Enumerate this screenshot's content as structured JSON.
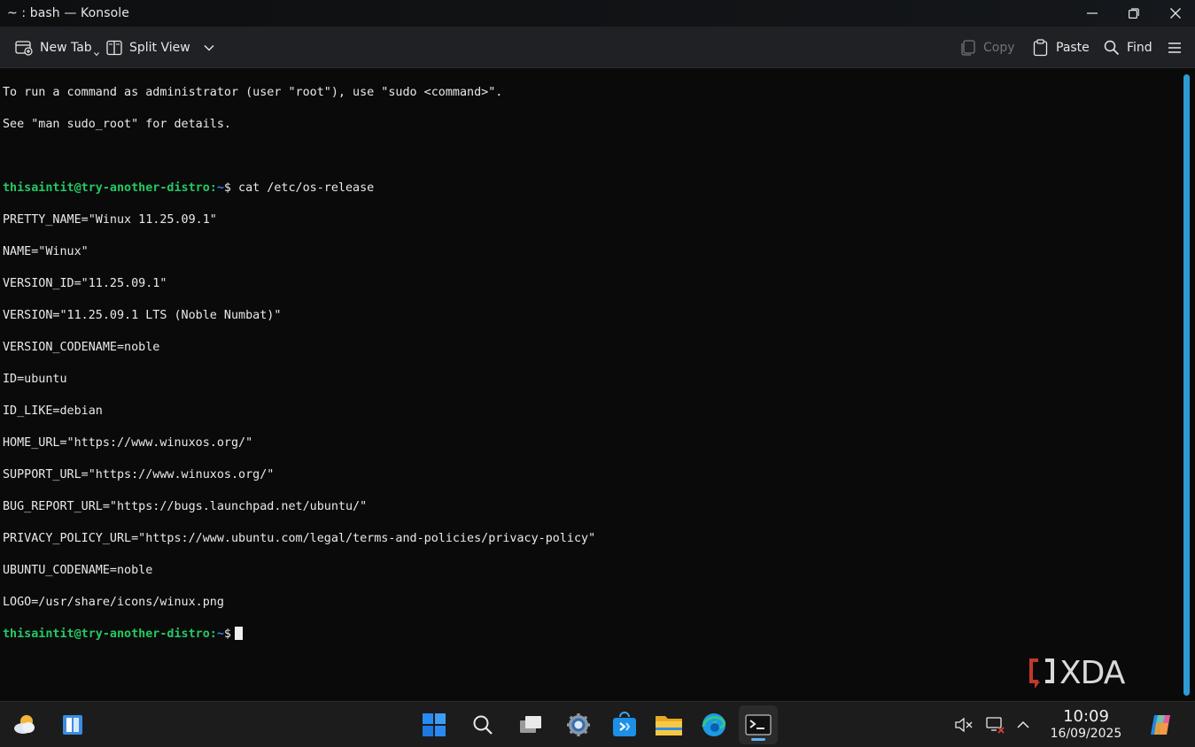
{
  "window": {
    "title": "~ : bash — Konsole"
  },
  "toolbar": {
    "new_tab": "New Tab",
    "split_view": "Split View",
    "copy": "Copy",
    "paste": "Paste",
    "find": "Find"
  },
  "terminal": {
    "intro": [
      "To run a command as administrator (user \"root\"), use \"sudo <command>\".",
      "See \"man sudo_root\" for details."
    ],
    "prompt_user_host": "thisaintit@try-another-distro",
    "prompt_sep": ":",
    "prompt_path": "~",
    "prompt_symbol": "$",
    "command": " cat /etc/os-release",
    "output": [
      "PRETTY_NAME=\"Winux 11.25.09.1\"",
      "NAME=\"Winux\"",
      "VERSION_ID=\"11.25.09.1\"",
      "VERSION=\"11.25.09.1 LTS (Noble Numbat)\"",
      "VERSION_CODENAME=noble",
      "ID=ubuntu",
      "ID_LIKE=debian",
      "HOME_URL=\"https://www.winuxos.org/\"",
      "SUPPORT_URL=\"https://www.winuxos.org/\"",
      "BUG_REPORT_URL=\"https://bugs.launchpad.net/ubuntu/\"",
      "PRIVACY_POLICY_URL=\"https://www.ubuntu.com/legal/terms-and-policies/privacy-policy\"",
      "UBUNTU_CODENAME=noble",
      "LOGO=/usr/share/icons/winux.png"
    ],
    "colors": {
      "prompt_user": "#24c964",
      "prompt_path": "#2f86e6",
      "scrollbar": "#2d9bd4"
    }
  },
  "watermark": {
    "text": "XDA"
  },
  "taskbar": {
    "icons": [
      "weather-icon",
      "widgets-icon",
      "start-icon",
      "search-icon",
      "task-view-icon",
      "settings-icon",
      "store-icon",
      "file-explorer-icon",
      "edge-icon",
      "terminal-icon"
    ],
    "tray_icons": [
      "speaker-muted-icon",
      "network-disconnected-icon",
      "chevron-up-icon",
      "copilot-icon"
    ],
    "time": "10:09",
    "date": "16/09/2025"
  }
}
